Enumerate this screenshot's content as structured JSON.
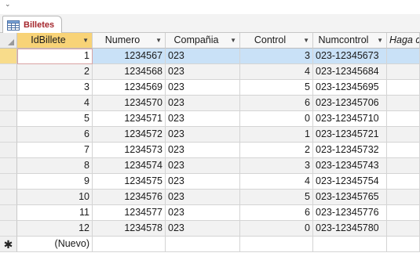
{
  "app": {
    "quick_access_glyph": "⌄"
  },
  "tab": {
    "label": "Billetes",
    "icon": "table-icon"
  },
  "columns": [
    {
      "label": "IdBillete",
      "dropdown": true
    },
    {
      "label": "Numero",
      "dropdown": true
    },
    {
      "label": "Compañia",
      "dropdown": true
    },
    {
      "label": "Control",
      "dropdown": true
    },
    {
      "label": "Numcontrol",
      "dropdown": true
    },
    {
      "label": "Haga c",
      "dropdown": false
    }
  ],
  "rows": [
    {
      "id": "1",
      "numero": "1234567",
      "compania": "023",
      "control": "3",
      "numcontrol": "023-12345673"
    },
    {
      "id": "2",
      "numero": "1234568",
      "compania": "023",
      "control": "4",
      "numcontrol": "023-12345684"
    },
    {
      "id": "3",
      "numero": "1234569",
      "compania": "023",
      "control": "5",
      "numcontrol": "023-12345695"
    },
    {
      "id": "4",
      "numero": "1234570",
      "compania": "023",
      "control": "6",
      "numcontrol": "023-12345706"
    },
    {
      "id": "5",
      "numero": "1234571",
      "compania": "023",
      "control": "0",
      "numcontrol": "023-12345710"
    },
    {
      "id": "6",
      "numero": "1234572",
      "compania": "023",
      "control": "1",
      "numcontrol": "023-12345721"
    },
    {
      "id": "7",
      "numero": "1234573",
      "compania": "023",
      "control": "2",
      "numcontrol": "023-12345732"
    },
    {
      "id": "8",
      "numero": "1234574",
      "compania": "023",
      "control": "3",
      "numcontrol": "023-12345743"
    },
    {
      "id": "9",
      "numero": "1234575",
      "compania": "023",
      "control": "4",
      "numcontrol": "023-12345754"
    },
    {
      "id": "10",
      "numero": "1234576",
      "compania": "023",
      "control": "5",
      "numcontrol": "023-12345765"
    },
    {
      "id": "11",
      "numero": "1234577",
      "compania": "023",
      "control": "6",
      "numcontrol": "023-12345776"
    },
    {
      "id": "12",
      "numero": "1234578",
      "compania": "023",
      "control": "0",
      "numcontrol": "023-12345780"
    }
  ],
  "new_row": {
    "marker": "✱",
    "label": "(Nuevo)"
  },
  "selected_row": 0,
  "colors": {
    "active_header": "#f8d377",
    "selection": "#c9e1f7",
    "tab_text": "#a4262c"
  }
}
